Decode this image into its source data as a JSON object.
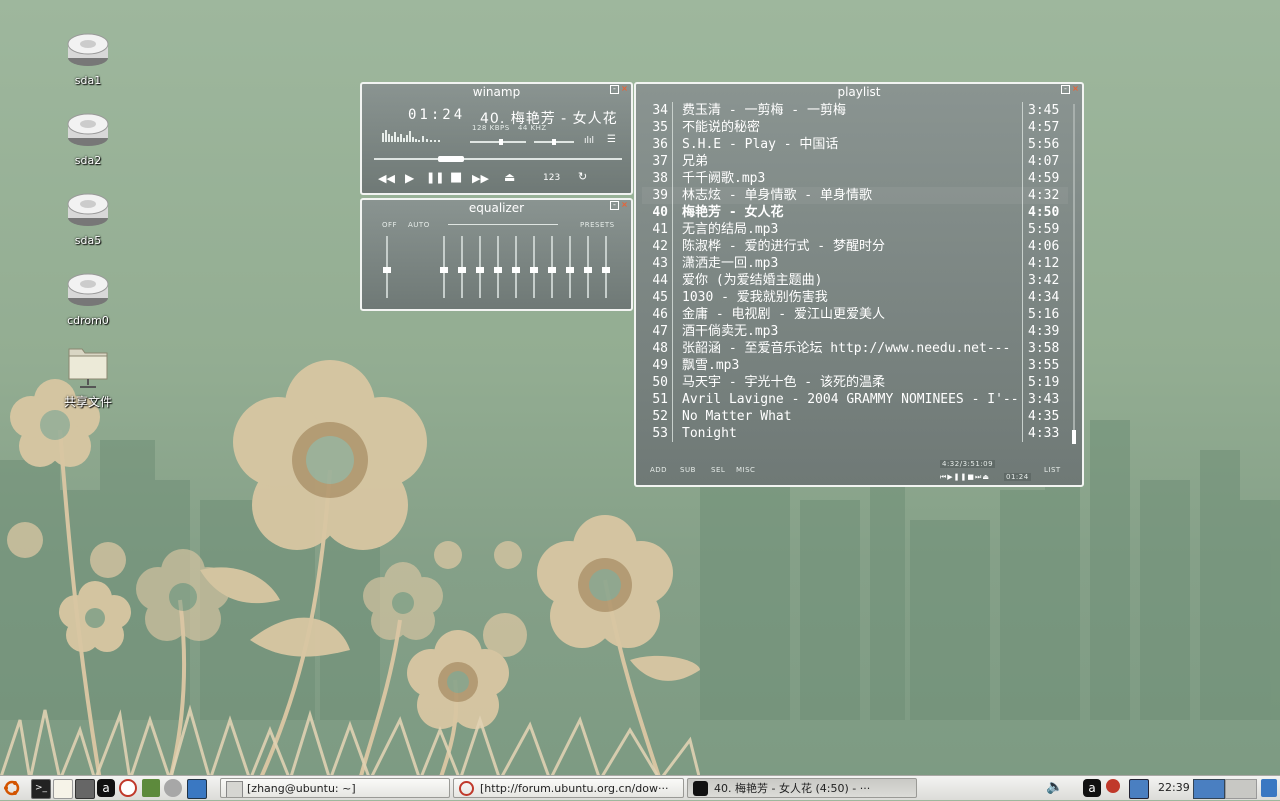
{
  "desktop": {
    "icons": [
      {
        "label": "sda1",
        "icon": "harddisk-icon"
      },
      {
        "label": "sda2",
        "icon": "harddisk-icon"
      },
      {
        "label": "sda5",
        "icon": "harddisk-icon"
      },
      {
        "label": "cdrom0",
        "icon": "harddisk-icon"
      },
      {
        "label": "共享文件",
        "icon": "shared-folder-icon"
      }
    ]
  },
  "player": {
    "title": "winamp",
    "time": "01:24",
    "track": "40. 梅艳芳 - 女人花",
    "kbps": "128",
    "kbps_unit": "KBPS",
    "khz": "44",
    "khz_unit": "KHZ",
    "counter": "123",
    "volume": 0.55,
    "balance": 0.5,
    "seek": 0.29
  },
  "equalizer": {
    "title": "equalizer",
    "off_label": "OFF",
    "auto_label": "AUTO",
    "presets_label": "PRESETS",
    "preamp": 0.5,
    "bands": [
      0.5,
      0.5,
      0.5,
      0.5,
      0.5,
      0.5,
      0.5,
      0.5,
      0.5,
      0.5
    ]
  },
  "playlist": {
    "title": "playlist",
    "rows": [
      {
        "n": "34",
        "title": "费玉清 - 一剪梅 - 一剪梅",
        "dur": "3:45"
      },
      {
        "n": "35",
        "title": "不能说的秘密",
        "dur": "4:57"
      },
      {
        "n": "36",
        "title": "S.H.E - Play - 中国话",
        "dur": "5:56"
      },
      {
        "n": "37",
        "title": "兄弟",
        "dur": "4:07"
      },
      {
        "n": "38",
        "title": "千千阙歌.mp3",
        "dur": "4:59"
      },
      {
        "n": "39",
        "title": "林志炫 - 单身情歌 - 单身情歌",
        "dur": "4:32"
      },
      {
        "n": "40",
        "title": "梅艳芳 - 女人花",
        "dur": "4:50"
      },
      {
        "n": "41",
        "title": "无言的结局.mp3",
        "dur": "5:59"
      },
      {
        "n": "42",
        "title": "陈淑桦 - 爱的进行式 - 梦醒时分",
        "dur": "4:06"
      },
      {
        "n": "43",
        "title": "潇洒走一回.mp3",
        "dur": "4:12"
      },
      {
        "n": "44",
        "title": "爱你 (为爱结婚主题曲)",
        "dur": "3:42"
      },
      {
        "n": "45",
        "title": "1030 - 爱我就别伤害我",
        "dur": "4:34"
      },
      {
        "n": "46",
        "title": "金庸 - 电视剧 - 爱江山更爱美人",
        "dur": "5:16"
      },
      {
        "n": "47",
        "title": "酒干倘卖无.mp3",
        "dur": "4:39"
      },
      {
        "n": "48",
        "title": "张韶涵 - 至爱音乐论坛  http://www.needu.net---",
        "dur": "3:58"
      },
      {
        "n": "49",
        "title": "飘雪.mp3",
        "dur": "3:55"
      },
      {
        "n": "50",
        "title": "马天宇 - 宇光十色 - 该死的温柔",
        "dur": "5:19"
      },
      {
        "n": "51",
        "title": "Avril Lavigne - 2004 GRAMMY NOMINEES - I'---",
        "dur": "3:43"
      },
      {
        "n": "52",
        "title": "No Matter What",
        "dur": "4:35"
      },
      {
        "n": "53",
        "title": "Tonight",
        "dur": "4:33"
      }
    ],
    "selected_row": "39",
    "current_row": "40",
    "buttons": {
      "add": "ADD",
      "sub": "SUB",
      "sel": "SEL",
      "misc": "MISC",
      "list": "LIST"
    },
    "total_time": "4:32/3:51:09",
    "mini_time": "01:24"
  },
  "taskbar": {
    "tasks": [
      {
        "label": "[zhang@ubuntu: ~]",
        "icon": "terminal-icon"
      },
      {
        "label": "[http://forum.ubuntu.org.cn/dow···",
        "icon": "browser-icon"
      },
      {
        "label": "40. 梅艳芳 - 女人花 (4:50) - ···",
        "icon": "audacious-icon"
      }
    ],
    "clock": "22:39"
  }
}
